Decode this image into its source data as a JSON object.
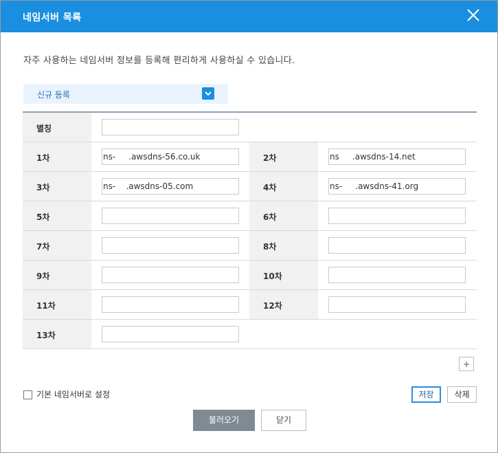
{
  "dialog": {
    "title": "네임서버 목록",
    "description": "자주 사용하는 네임서버 정보를 등록해 편리하게 사용하실 수 있습니다.",
    "select_value": "신규 등록"
  },
  "form": {
    "alias_label": "별칭",
    "alias_value": "",
    "ns": [
      {
        "label": "1차",
        "value": "ns-     .awsdns-56.co.uk"
      },
      {
        "label": "2차",
        "value": "ns     .awsdns-14.net"
      },
      {
        "label": "3차",
        "value": "ns-    .awsdns-05.com"
      },
      {
        "label": "4차",
        "value": "ns-     .awsdns-41.org"
      },
      {
        "label": "5차",
        "value": ""
      },
      {
        "label": "6차",
        "value": ""
      },
      {
        "label": "7차",
        "value": ""
      },
      {
        "label": "8차",
        "value": ""
      },
      {
        "label": "9차",
        "value": ""
      },
      {
        "label": "10차",
        "value": ""
      },
      {
        "label": "11차",
        "value": ""
      },
      {
        "label": "12차",
        "value": ""
      },
      {
        "label": "13차",
        "value": ""
      }
    ]
  },
  "actions": {
    "add_label": "+",
    "default_checkbox_label": "기본 네임서버로 설정",
    "save_label": "저장",
    "delete_label": "삭제",
    "load_label": "불러오기",
    "close_label": "닫기"
  },
  "colors": {
    "header": "#1a8fe0",
    "select_bg": "#e8f3fd",
    "load_button": "#7f8a94"
  }
}
